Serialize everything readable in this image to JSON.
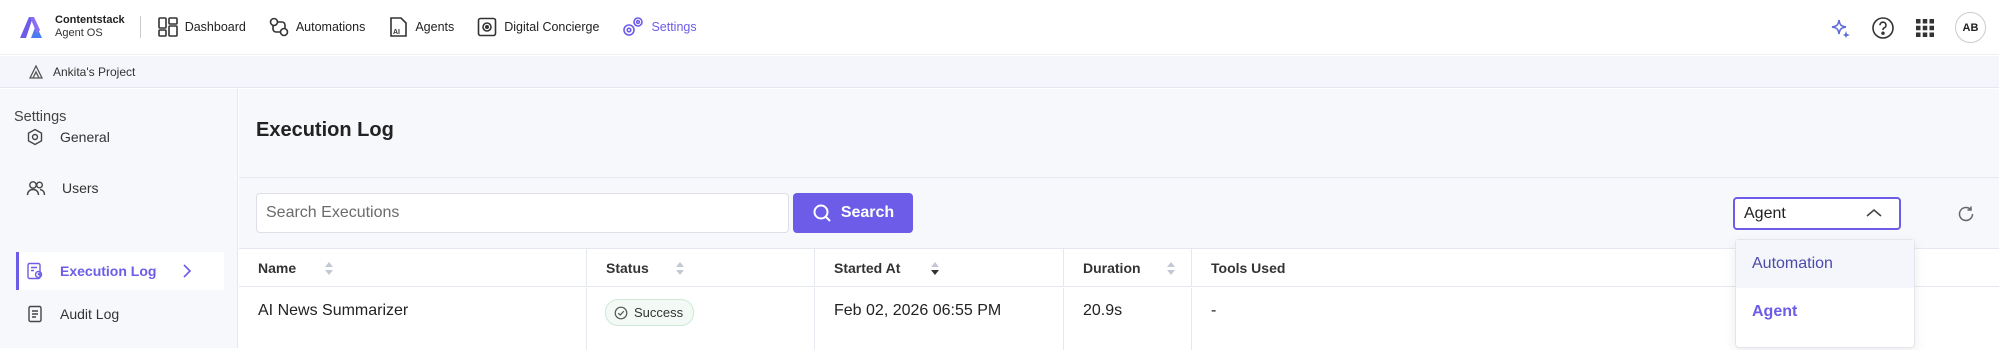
{
  "brand": {
    "name": "Contentstack",
    "product": "Agent OS"
  },
  "nav": [
    {
      "label": "Dashboard",
      "icon": "dashboard-icon"
    },
    {
      "label": "Automations",
      "icon": "automations-icon"
    },
    {
      "label": "Agents",
      "icon": "agents-icon"
    },
    {
      "label": "Digital Concierge",
      "icon": "concierge-icon"
    },
    {
      "label": "Settings",
      "icon": "settings-icon",
      "active": true
    }
  ],
  "header_right": {
    "avatar_initials": "AB",
    "icons": [
      "sparkle-icon",
      "help-icon",
      "apps-grid-icon"
    ]
  },
  "project": {
    "name": "Ankita's Project"
  },
  "sidebar": {
    "title": "Settings",
    "items": [
      {
        "label": "General",
        "icon": "gear-icon"
      },
      {
        "label": "Users",
        "icon": "users-icon"
      },
      {
        "label": "Execution Log",
        "icon": "execution-log-icon",
        "active": true
      },
      {
        "label": "Audit Log",
        "icon": "audit-log-icon"
      }
    ]
  },
  "page": {
    "title": "Execution Log"
  },
  "search": {
    "placeholder": "Search Executions",
    "button_label": "Search"
  },
  "type_filter": {
    "selected": "Agent",
    "open": true,
    "options": [
      "Automation",
      "Agent"
    ]
  },
  "table": {
    "columns": [
      "Name",
      "Status",
      "Started At",
      "Duration",
      "Tools Used"
    ],
    "rows": [
      {
        "name": "AI News Summarizer",
        "status": "Success",
        "started_at": "Feb 02, 2026 06:55 PM",
        "duration": "20.9s",
        "tools_used": "-"
      }
    ]
  },
  "colors": {
    "accent": "#6c5ce7",
    "success": "#2e9e5b",
    "page_bg": "#f6f8fb"
  }
}
